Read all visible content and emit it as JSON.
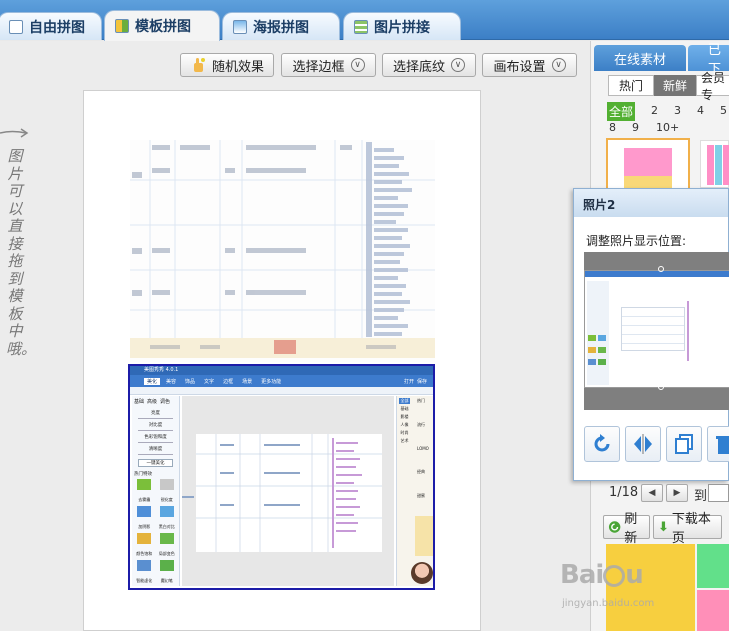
{
  "tabs": [
    {
      "label": "自由拼图",
      "active": false
    },
    {
      "label": "模板拼图",
      "active": true
    },
    {
      "label": "海报拼图",
      "active": false
    },
    {
      "label": "图片拼接",
      "active": false
    }
  ],
  "toolbar": {
    "random_label": "随机效果",
    "border_label": "选择边框",
    "texture_label": "选择底纹",
    "canvas_label": "画布设置"
  },
  "hint_text": "图片可以直接拖到模板中哦。",
  "embedded_screenshot": {
    "app_title": "美图秀秀 4.0.1",
    "nav_tabs": [
      "美化",
      "美容",
      "饰品",
      "文字",
      "边框",
      "场景",
      "更多功能"
    ],
    "top_buttons": [
      "打开",
      "保存"
    ],
    "side_headers": [
      "基础",
      "高级",
      "调色"
    ],
    "sliders": [
      "亮度",
      "对比度",
      "色彩饱和度",
      "清晰度"
    ],
    "one_click": "一键美化",
    "effects_header": "热门特效",
    "effects": [
      "去雾霾",
      "锐化度",
      "加阴影",
      "黑白对比",
      "颜色饱和",
      "局部变色",
      "智能虚化",
      "魔幻笔"
    ],
    "right_items": [
      "全部",
      "基础",
      "影楼",
      "人像",
      "时尚",
      "艺术"
    ],
    "right_labels": [
      "热门",
      "流行",
      "LOMO",
      "经典",
      "甜蜜"
    ]
  },
  "right_panel": {
    "tabs": [
      "在线素材",
      "已下"
    ],
    "subtabs": [
      "热门",
      "新鲜",
      "会员专"
    ],
    "page_numbers": [
      "全部",
      "2",
      "3",
      "4",
      "5",
      "8",
      "9",
      "10+"
    ],
    "pager_current": "1/18",
    "pager_goto": "到",
    "refresh_label": "刷新",
    "download_label": "下载本页"
  },
  "popup": {
    "title": "照片2",
    "label": "调整照片显示位置:",
    "buttons": [
      "rotate-icon",
      "flip-icon",
      "copy-icon",
      "delete-icon"
    ]
  },
  "colors": {
    "accent_blue": "#3c7fc6",
    "selection_border": "#1c1ca8",
    "green_active": "#52b032",
    "thumb_pink": "#ff99cc",
    "thumb_yellow": "#f9d878"
  }
}
